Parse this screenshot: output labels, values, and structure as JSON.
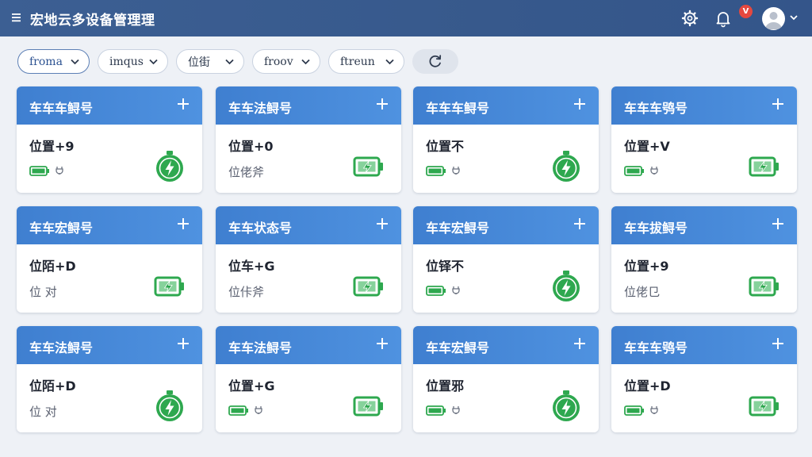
{
  "header": {
    "title": "宏地云多设备管理理",
    "notification_count": "V"
  },
  "filters": [
    {
      "label": "froma",
      "active": true
    },
    {
      "label": "imqus",
      "active": false
    },
    {
      "label": "位街",
      "active": false
    },
    {
      "label": "froov",
      "active": false
    },
    {
      "label": "ftreun",
      "active": false
    }
  ],
  "colors": {
    "header_bg": "#3c5f93",
    "card_header": "#4a8ad8",
    "battery_green": "#2ea84f",
    "badge_red": "#e5483f"
  },
  "cards": [
    {
      "title": "车车车鲟号",
      "location": "位置+9",
      "status": "",
      "status_icon": "mini-battery-icon",
      "big_icon": "charging-circle-icon"
    },
    {
      "title": "车车法鲟号",
      "location": "位置+0",
      "status": "位佬斧",
      "status_icon": "",
      "big_icon": "battery-charging-icon"
    },
    {
      "title": "车车车鲟号",
      "location": "位置不",
      "status": "",
      "status_icon": "mini-battery-icon",
      "big_icon": "charging-circle-icon"
    },
    {
      "title": "车车车鸮号",
      "location": "位置+V",
      "status": "",
      "status_icon": "mini-battery-icon",
      "big_icon": "battery-charging-icon"
    },
    {
      "title": "车车宏鲟号",
      "location": "位陌+D",
      "status": "位 对",
      "status_icon": "",
      "big_icon": "battery-charging-icon"
    },
    {
      "title": "车车状态号",
      "location": "位车+G",
      "status": "位佧斧",
      "status_icon": "",
      "big_icon": "battery-charging-icon"
    },
    {
      "title": "车车宏鲟号",
      "location": "位铎不",
      "status": "",
      "status_icon": "mini-battery-icon",
      "big_icon": "charging-circle-icon"
    },
    {
      "title": "车车拔鲟号",
      "location": "位置+9",
      "status": "位佬㔾",
      "status_icon": "",
      "big_icon": "battery-charging-icon"
    },
    {
      "title": "车车法鲟号",
      "location": "位陌+D",
      "status": "位 对",
      "status_icon": "",
      "big_icon": "charging-circle-icon"
    },
    {
      "title": "车车法鲟号",
      "location": "位置+G",
      "status": "",
      "status_icon": "mini-battery-icon",
      "big_icon": "battery-charging-icon"
    },
    {
      "title": "车车宏鲟号",
      "location": "位置邪",
      "status": "",
      "status_icon": "mini-battery-icon",
      "big_icon": "charging-circle-icon"
    },
    {
      "title": "车车车鸮号",
      "location": "位置+D",
      "status": "",
      "status_icon": "mini-battery-icon",
      "big_icon": "battery-charging-icon"
    }
  ]
}
